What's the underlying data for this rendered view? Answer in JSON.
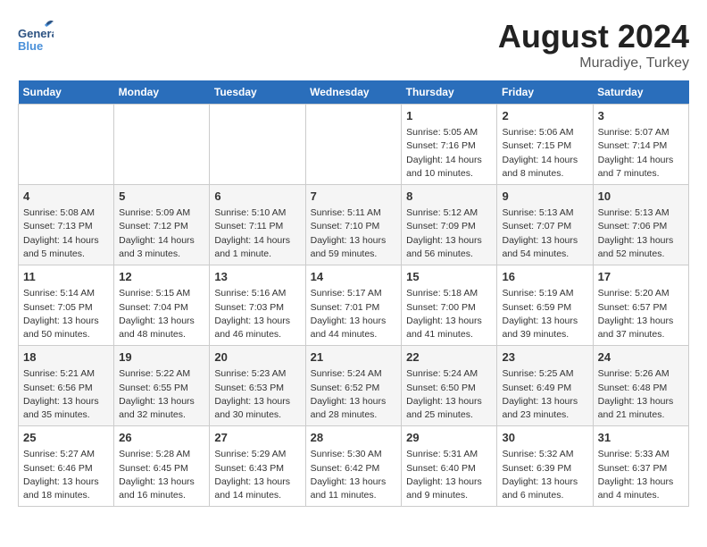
{
  "header": {
    "logo_general": "General",
    "logo_blue": "Blue",
    "month_year": "August 2024",
    "location": "Muradiye, Turkey"
  },
  "days_of_week": [
    "Sunday",
    "Monday",
    "Tuesday",
    "Wednesday",
    "Thursday",
    "Friday",
    "Saturday"
  ],
  "weeks": [
    [
      {
        "day": "",
        "content": ""
      },
      {
        "day": "",
        "content": ""
      },
      {
        "day": "",
        "content": ""
      },
      {
        "day": "",
        "content": ""
      },
      {
        "day": "1",
        "content": "Sunrise: 5:05 AM\nSunset: 7:16 PM\nDaylight: 14 hours\nand 10 minutes."
      },
      {
        "day": "2",
        "content": "Sunrise: 5:06 AM\nSunset: 7:15 PM\nDaylight: 14 hours\nand 8 minutes."
      },
      {
        "day": "3",
        "content": "Sunrise: 5:07 AM\nSunset: 7:14 PM\nDaylight: 14 hours\nand 7 minutes."
      }
    ],
    [
      {
        "day": "4",
        "content": "Sunrise: 5:08 AM\nSunset: 7:13 PM\nDaylight: 14 hours\nand 5 minutes."
      },
      {
        "day": "5",
        "content": "Sunrise: 5:09 AM\nSunset: 7:12 PM\nDaylight: 14 hours\nand 3 minutes."
      },
      {
        "day": "6",
        "content": "Sunrise: 5:10 AM\nSunset: 7:11 PM\nDaylight: 14 hours\nand 1 minute."
      },
      {
        "day": "7",
        "content": "Sunrise: 5:11 AM\nSunset: 7:10 PM\nDaylight: 13 hours\nand 59 minutes."
      },
      {
        "day": "8",
        "content": "Sunrise: 5:12 AM\nSunset: 7:09 PM\nDaylight: 13 hours\nand 56 minutes."
      },
      {
        "day": "9",
        "content": "Sunrise: 5:13 AM\nSunset: 7:07 PM\nDaylight: 13 hours\nand 54 minutes."
      },
      {
        "day": "10",
        "content": "Sunrise: 5:13 AM\nSunset: 7:06 PM\nDaylight: 13 hours\nand 52 minutes."
      }
    ],
    [
      {
        "day": "11",
        "content": "Sunrise: 5:14 AM\nSunset: 7:05 PM\nDaylight: 13 hours\nand 50 minutes."
      },
      {
        "day": "12",
        "content": "Sunrise: 5:15 AM\nSunset: 7:04 PM\nDaylight: 13 hours\nand 48 minutes."
      },
      {
        "day": "13",
        "content": "Sunrise: 5:16 AM\nSunset: 7:03 PM\nDaylight: 13 hours\nand 46 minutes."
      },
      {
        "day": "14",
        "content": "Sunrise: 5:17 AM\nSunset: 7:01 PM\nDaylight: 13 hours\nand 44 minutes."
      },
      {
        "day": "15",
        "content": "Sunrise: 5:18 AM\nSunset: 7:00 PM\nDaylight: 13 hours\nand 41 minutes."
      },
      {
        "day": "16",
        "content": "Sunrise: 5:19 AM\nSunset: 6:59 PM\nDaylight: 13 hours\nand 39 minutes."
      },
      {
        "day": "17",
        "content": "Sunrise: 5:20 AM\nSunset: 6:57 PM\nDaylight: 13 hours\nand 37 minutes."
      }
    ],
    [
      {
        "day": "18",
        "content": "Sunrise: 5:21 AM\nSunset: 6:56 PM\nDaylight: 13 hours\nand 35 minutes."
      },
      {
        "day": "19",
        "content": "Sunrise: 5:22 AM\nSunset: 6:55 PM\nDaylight: 13 hours\nand 32 minutes."
      },
      {
        "day": "20",
        "content": "Sunrise: 5:23 AM\nSunset: 6:53 PM\nDaylight: 13 hours\nand 30 minutes."
      },
      {
        "day": "21",
        "content": "Sunrise: 5:24 AM\nSunset: 6:52 PM\nDaylight: 13 hours\nand 28 minutes."
      },
      {
        "day": "22",
        "content": "Sunrise: 5:24 AM\nSunset: 6:50 PM\nDaylight: 13 hours\nand 25 minutes."
      },
      {
        "day": "23",
        "content": "Sunrise: 5:25 AM\nSunset: 6:49 PM\nDaylight: 13 hours\nand 23 minutes."
      },
      {
        "day": "24",
        "content": "Sunrise: 5:26 AM\nSunset: 6:48 PM\nDaylight: 13 hours\nand 21 minutes."
      }
    ],
    [
      {
        "day": "25",
        "content": "Sunrise: 5:27 AM\nSunset: 6:46 PM\nDaylight: 13 hours\nand 18 minutes."
      },
      {
        "day": "26",
        "content": "Sunrise: 5:28 AM\nSunset: 6:45 PM\nDaylight: 13 hours\nand 16 minutes."
      },
      {
        "day": "27",
        "content": "Sunrise: 5:29 AM\nSunset: 6:43 PM\nDaylight: 13 hours\nand 14 minutes."
      },
      {
        "day": "28",
        "content": "Sunrise: 5:30 AM\nSunset: 6:42 PM\nDaylight: 13 hours\nand 11 minutes."
      },
      {
        "day": "29",
        "content": "Sunrise: 5:31 AM\nSunset: 6:40 PM\nDaylight: 13 hours\nand 9 minutes."
      },
      {
        "day": "30",
        "content": "Sunrise: 5:32 AM\nSunset: 6:39 PM\nDaylight: 13 hours\nand 6 minutes."
      },
      {
        "day": "31",
        "content": "Sunrise: 5:33 AM\nSunset: 6:37 PM\nDaylight: 13 hours\nand 4 minutes."
      }
    ]
  ]
}
